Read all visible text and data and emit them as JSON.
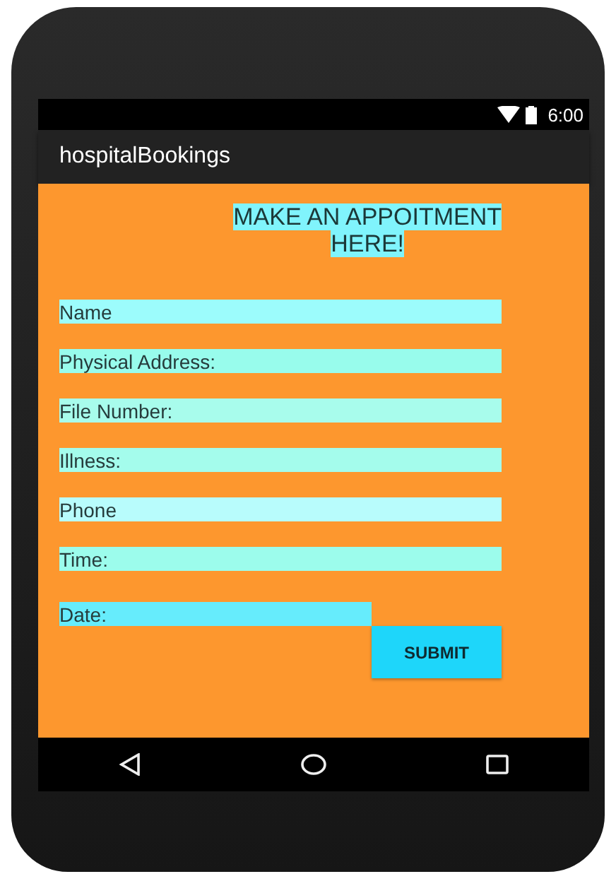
{
  "status_bar": {
    "time": "6:00"
  },
  "app_bar": {
    "title": "hospitalBookings"
  },
  "form": {
    "heading_lines": [
      "MAKE AN APPOITMENT",
      "HERE!"
    ],
    "fields": [
      {
        "placeholder": "Name",
        "color": "#9cfcfc"
      },
      {
        "placeholder": "Physical Address:",
        "color": "#98fcec"
      },
      {
        "placeholder": "File Number:",
        "color": "#a8fcec"
      },
      {
        "placeholder": "Illness:",
        "color": "#a4fcec"
      },
      {
        "placeholder": "Phone",
        "color": "#b8fcfc"
      },
      {
        "placeholder": "Time:",
        "color": "#9cfcec"
      },
      {
        "placeholder": "Date:",
        "color": "#66ecfc"
      }
    ],
    "submit": "SUBMIT"
  }
}
